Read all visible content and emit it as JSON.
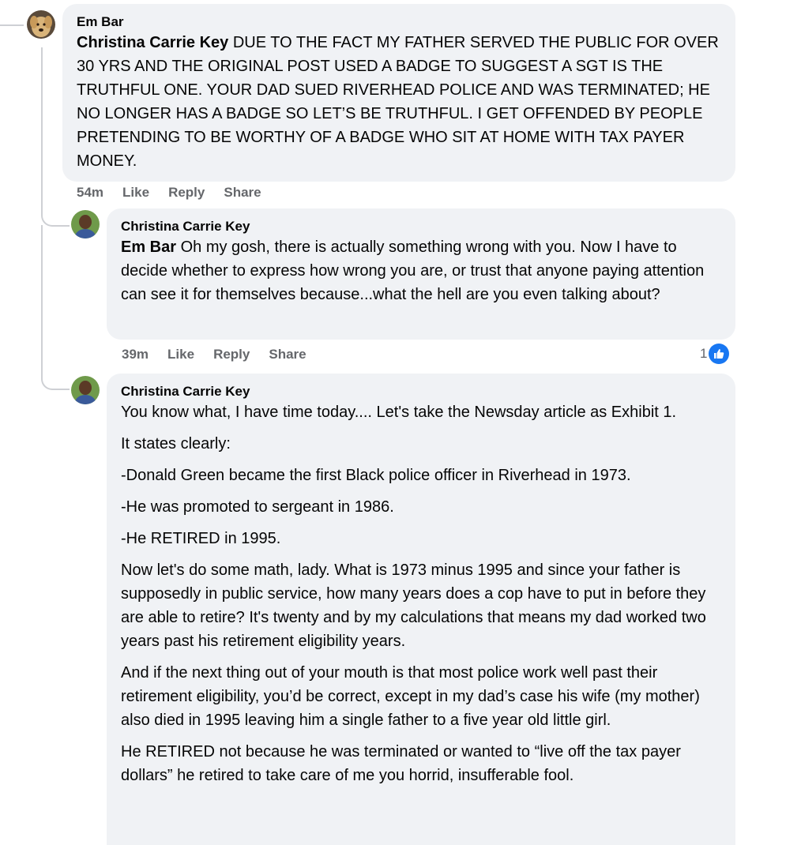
{
  "comments": [
    {
      "author": "Em Bar",
      "mention": "Christina Carrie Key",
      "text": " DUE TO THE FACT MY FATHER SERVED THE PUBLIC FOR OVER 30 YRS AND THE ORIGINAL POST USED A BADGE TO SUGGEST A SGT IS THE TRUTHFUL ONE. YOUR DAD SUED RIVERHEAD POLICE AND WAS TERMINATED; HE NO LONGER HAS A BADGE SO LET’S BE TRUTHFUL. I GET OFFENDED BY PEOPLE PRETENDING TO BE WORTHY OF A BADGE WHO SIT AT HOME WITH TAX PAYER MONEY.",
      "time": "54m",
      "like": "Like",
      "reply": "Reply",
      "share": "Share"
    },
    {
      "author": "Christina Carrie Key",
      "mention": "Em Bar",
      "text": " Oh my gosh, there is actually something wrong with you. Now I have to decide whether to express how wrong you are, or trust that anyone paying attention can see it for themselves because...what the hell are you even talking about?",
      "time": "39m",
      "like": "Like",
      "reply": "Reply",
      "share": "Share",
      "reaction_count": "1",
      "reaction_icon": "thumbs-up-icon"
    },
    {
      "author": "Christina Carrie Key",
      "paragraphs": [
        "You know what, I have time today.... Let's take the Newsday article as Exhibit 1.",
        "It states clearly:",
        "-Donald Green became the first Black police officer in Riverhead in 1973.",
        "-He was promoted to sergeant in 1986.",
        "-He RETIRED in 1995.",
        "Now let's do some math, lady. What is 1973 minus 1995 and since your father is supposedly in public service, how many years does a cop have to put in before they are able to retire? It's twenty and by my calculations that means my dad worked two years past his retirement eligibility years.",
        "And if the next thing out of your mouth is that most police work well past their retirement eligibility, you’d be correct, except in my dad’s case his wife (my mother) also died in 1995 leaving him a single father to a five year old little girl.",
        "He RETIRED not because he was terminated or wanted to “live off the tax payer dollars” he retired to take care of me you horrid, insufferable fool."
      ]
    }
  ],
  "colors": {
    "bubble": "#f0f2f5",
    "meta": "#65676b",
    "like_blue": "#1877f2"
  }
}
